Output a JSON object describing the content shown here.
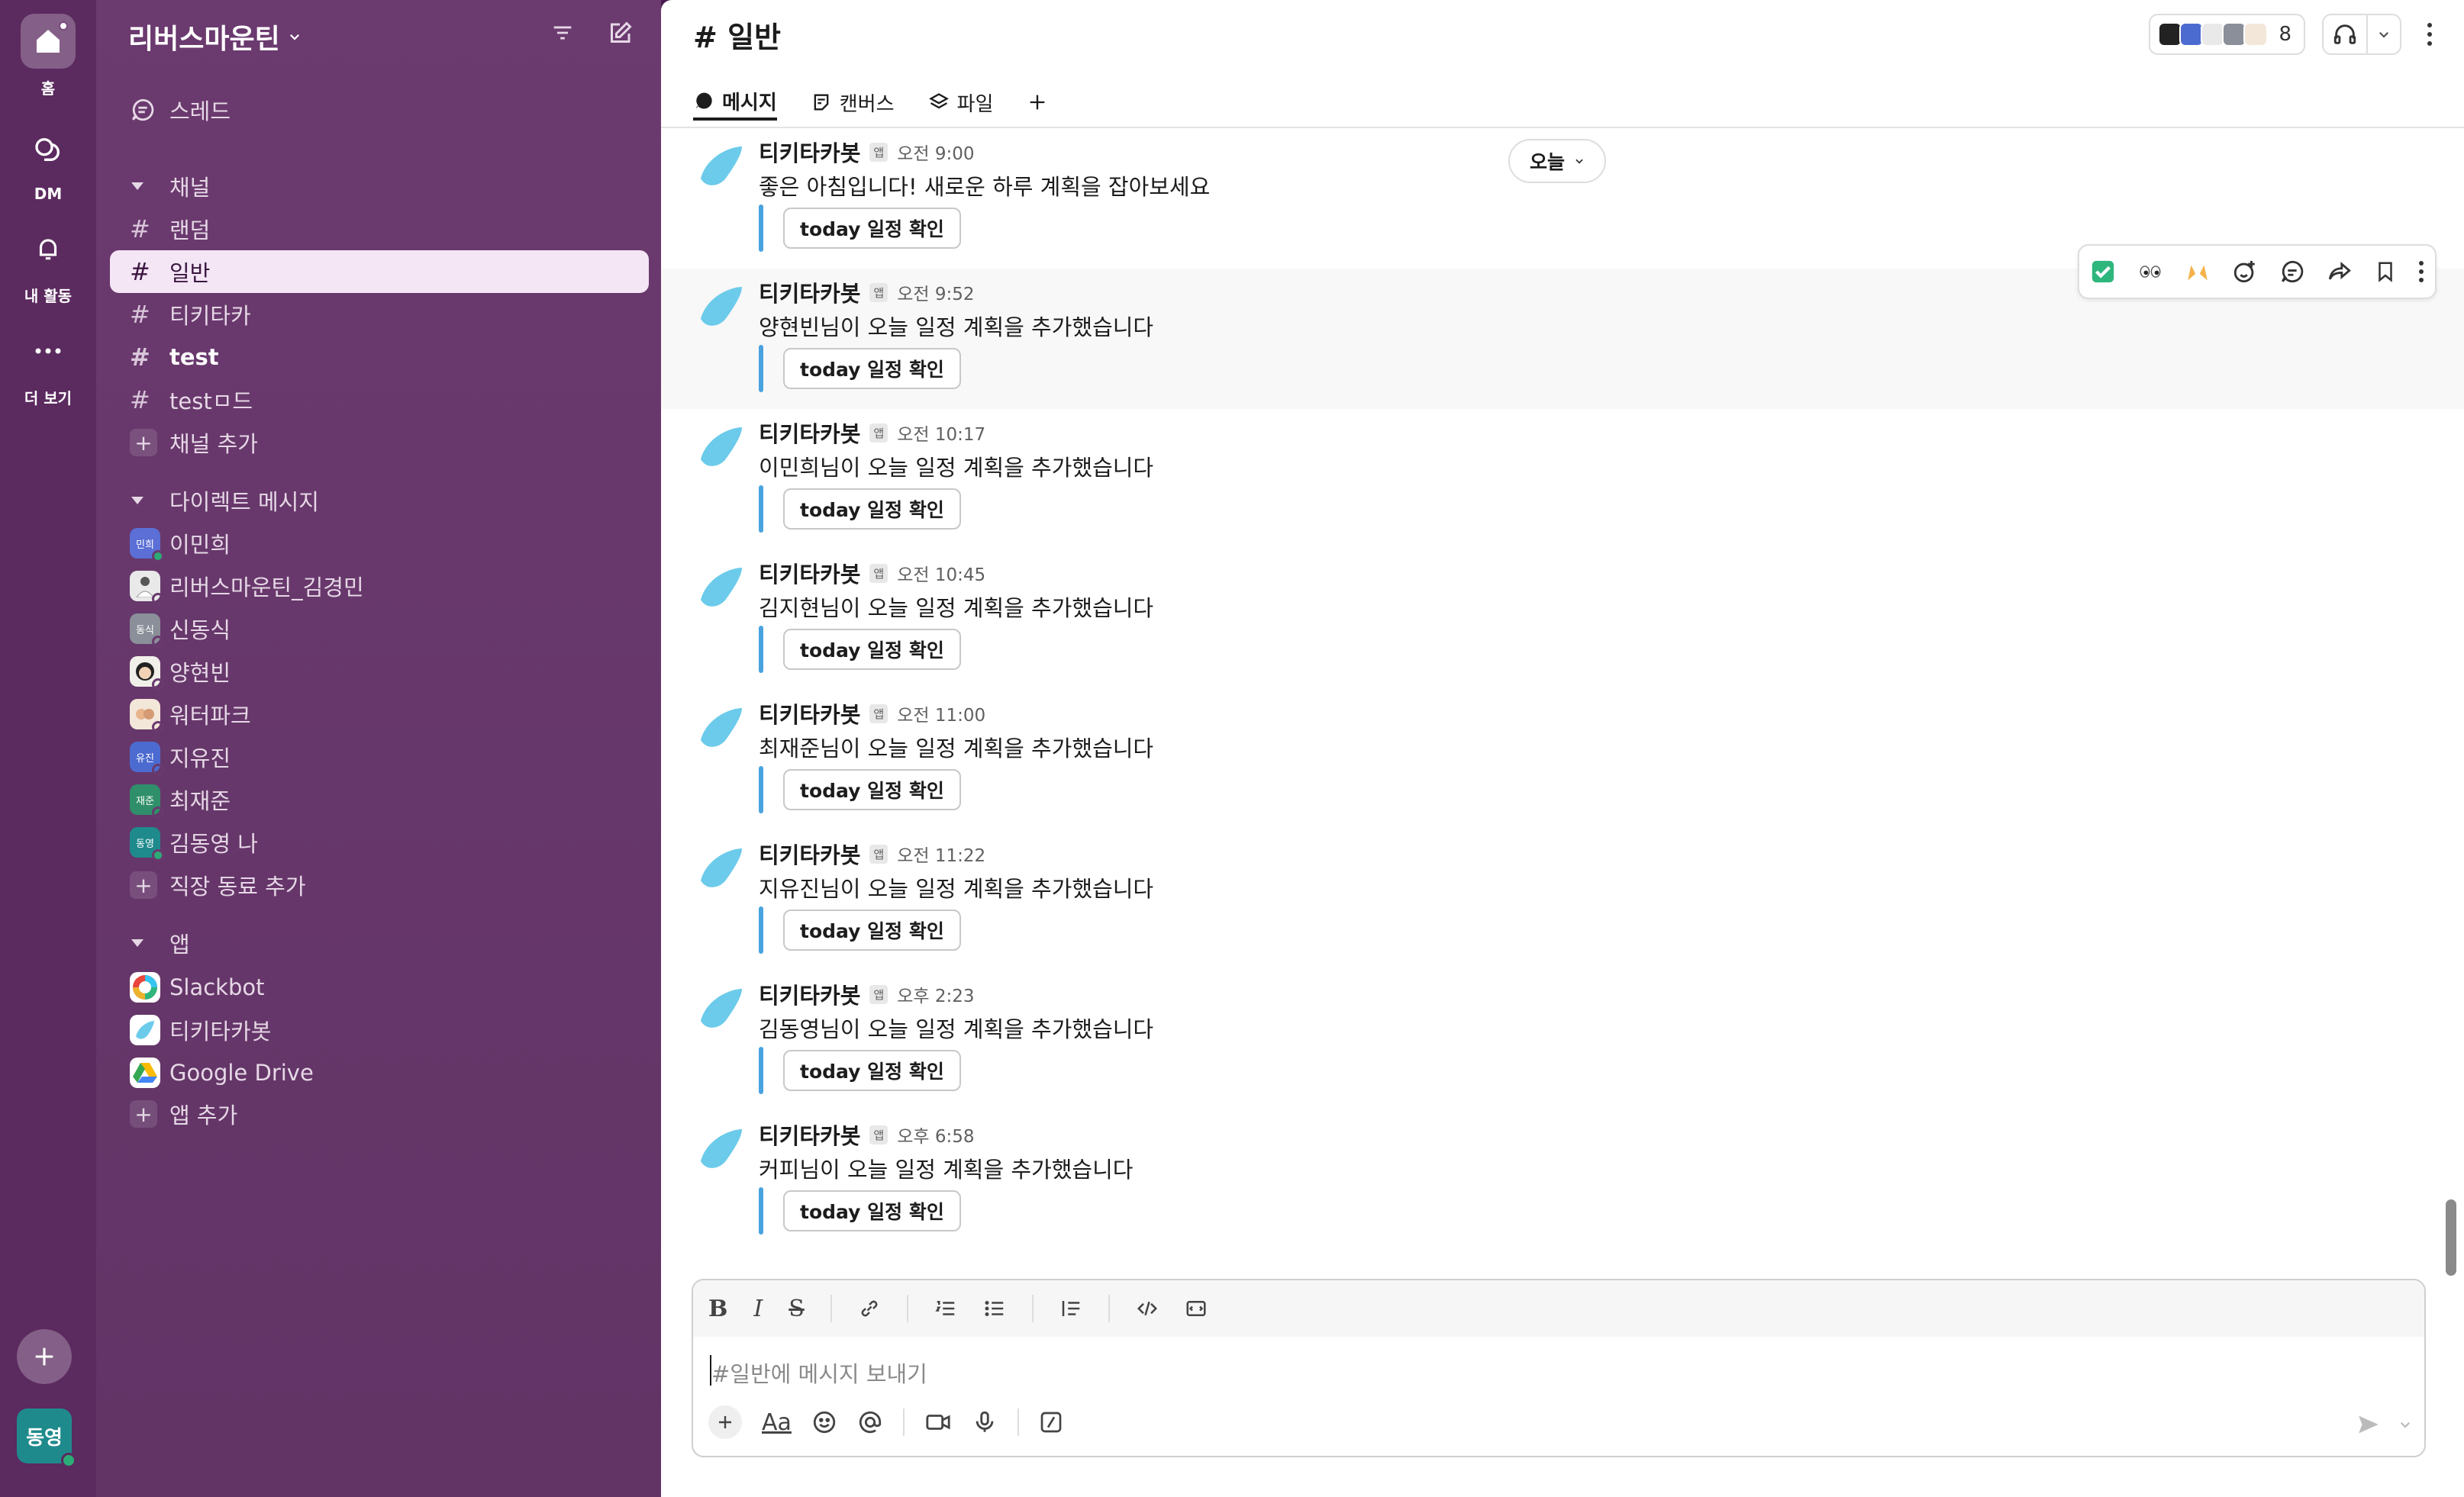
{
  "rail": {
    "items": [
      {
        "label": "홈"
      },
      {
        "label": "DM"
      },
      {
        "label": "내 활동"
      },
      {
        "label": "더 보기"
      }
    ],
    "avatar_text": "동영"
  },
  "sidebar": {
    "workspace_name": "리버스마운틴",
    "threads_label": "스레드",
    "channels_header": "채널",
    "channels": [
      {
        "name": "랜덤",
        "active": false,
        "bold": false
      },
      {
        "name": "일반",
        "active": true,
        "bold": false
      },
      {
        "name": "티키타카",
        "active": false,
        "bold": false
      },
      {
        "name": "test",
        "active": false,
        "bold": true
      },
      {
        "name": "testㅁ드",
        "active": false,
        "bold": false
      }
    ],
    "add_channel": "채널 추가",
    "dm_header": "다이렉트 메시지",
    "dms": [
      {
        "name": "이민희",
        "avatar": "민희",
        "color": "#5b6fd6"
      },
      {
        "name": "리버스마운틴_김경민",
        "avatar": "",
        "color": "#e9e9e9"
      },
      {
        "name": "신동식",
        "avatar": "동식",
        "color": "#8a8f99"
      },
      {
        "name": "양현빈",
        "avatar": "",
        "color": "#f1efe9"
      },
      {
        "name": "워터파크",
        "avatar": "",
        "color": "#f3e7da"
      },
      {
        "name": "지유진",
        "avatar": "유진",
        "color": "#4c6bd0"
      },
      {
        "name": "최재준",
        "avatar": "재준",
        "color": "#2f8f6a"
      },
      {
        "name": "김동영  나",
        "avatar": "동영",
        "color": "#1f8a8c"
      }
    ],
    "add_coworker": "직장 동료 추가",
    "apps_header": "앱",
    "apps": [
      {
        "name": "Slackbot"
      },
      {
        "name": "티키타카봇"
      },
      {
        "name": "Google Drive"
      }
    ],
    "add_app": "앱 추가"
  },
  "main": {
    "channel_title": "# 일반",
    "member_count": "8",
    "tabs": [
      {
        "label": "메시지"
      },
      {
        "label": "캔버스"
      },
      {
        "label": "파일"
      }
    ],
    "date_divider": "오늘",
    "bot_name": "티키타카봇",
    "app_badge": "앱",
    "button_label": "today 일정 확인",
    "messages": [
      {
        "time": "오전 9:00",
        "text": "좋은 아침입니다! 새로운 하루 계획을 잡아보세요"
      },
      {
        "time": "오전 9:52",
        "text": "양현빈님이 오늘 일정 계획을 추가했습니다"
      },
      {
        "time": "오전 10:17",
        "text": "이민희님이 오늘 일정 계획을 추가했습니다"
      },
      {
        "time": "오전 10:45",
        "text": "김지현님이 오늘 일정 계획을 추가했습니다"
      },
      {
        "time": "오전 11:00",
        "text": "최재준님이 오늘 일정 계획을 추가했습니다"
      },
      {
        "time": "오전 11:22",
        "text": "지유진님이 오늘 일정 계획을 추가했습니다"
      },
      {
        "time": "오후 2:23",
        "text": "김동영님이 오늘 일정 계획을 추가했습니다"
      },
      {
        "time": "오후 6:58",
        "text": "커피님이 오늘 일정 계획을 추가했습니다"
      }
    ],
    "composer_placeholder": "#일반에 메시지 보내기",
    "composer_aa": "Aa"
  },
  "colors": {
    "rail_bg": "#5b2a5f",
    "sidebar_bg": "#6a3a6e",
    "active_row_bg": "#f4e6f5",
    "attach_bar": "#4aa3df",
    "presence": "#2bac76"
  }
}
